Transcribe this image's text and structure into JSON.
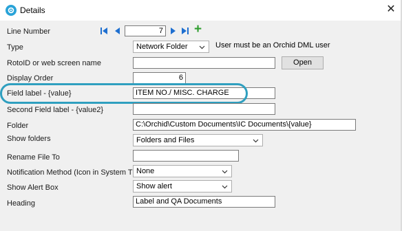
{
  "window": {
    "title": "Details",
    "close_glyph": "✕",
    "accent": "#29a3d8"
  },
  "nav": {
    "first_icon": "first-record-icon",
    "prev_icon": "previous-record-icon",
    "next_icon": "next-record-icon",
    "last_icon": "last-record-icon",
    "add_icon": "add-icon",
    "add_glyph": "+"
  },
  "form": {
    "line_number": {
      "label": "Line Number",
      "value": "7"
    },
    "type": {
      "label": "Type",
      "value": "Network Folder",
      "note": "User must be an Orchid DML user"
    },
    "roto_id": {
      "label": "RotoID or web screen name",
      "value": "",
      "open_label": "Open"
    },
    "display_order": {
      "label": "Display Order",
      "value": "6"
    },
    "field_label": {
      "label": "Field label - {value}",
      "value": "ITEM NO./ MISC. CHARGE"
    },
    "second_field_label": {
      "label": "Second Field label - {value2}",
      "value": ""
    },
    "folder": {
      "label": "Folder",
      "value": "C:\\Orchid\\Custom Documents\\IC Documents\\{value}"
    },
    "show_folders": {
      "label": "Show folders",
      "value": "Folders and Files"
    },
    "rename_file_to": {
      "label": "Rename File To",
      "value": ""
    },
    "notification_method": {
      "label": "Notification Method (Icon in System Tray)",
      "value": "None"
    },
    "show_alert_box": {
      "label": "Show Alert Box",
      "value": "Show alert"
    },
    "heading": {
      "label": "Heading",
      "value": "Label and QA Documents"
    }
  },
  "colors": {
    "highlight": "#2f9fbf",
    "add_green": "#2e9e2e",
    "nav_blue": "#1e6fd0"
  }
}
